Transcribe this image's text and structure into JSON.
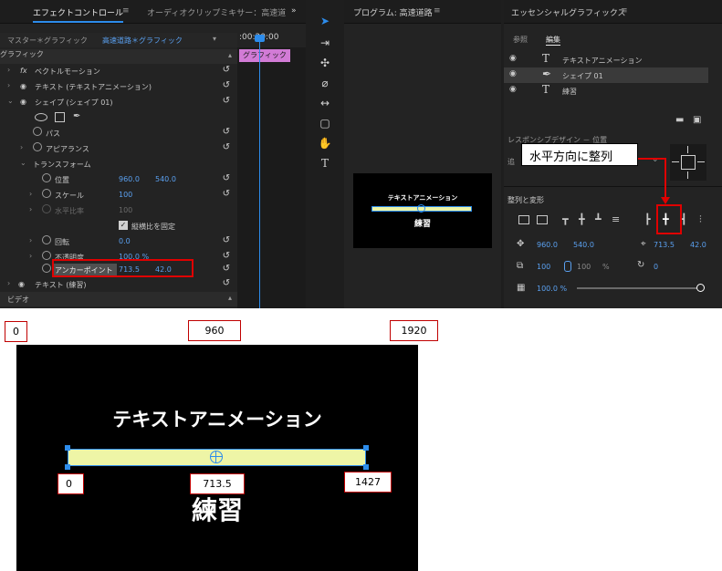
{
  "effect_controls": {
    "tab_title": "エフェクトコントロール",
    "tab_menu": "≡",
    "tab_other": "オーディオクリップミキサー：高速道",
    "overflow": "»",
    "master_label": "マスター＊グラフィック",
    "sequence_label": "高速道路＊グラフィック",
    "timecode": ":00:20:00",
    "clip_label": "グラフィック",
    "source_header": "グラフィック",
    "rows": {
      "vector_motion": "ベクトルモーション",
      "fx": "fx",
      "text_anim": "テキスト (テキストアニメーション)",
      "shape": "シェイプ (シェイプ 01)",
      "path": "パス",
      "appearance": "アピアランス",
      "transform": "トランスフォーム",
      "position": "位置",
      "position_x": "960.0",
      "position_y": "540.0",
      "scale": "スケール",
      "scale_val": "100",
      "scale_h": "水平比率",
      "scale_h_val": "100",
      "uniform": "縦横比を固定",
      "rotation": "回転",
      "rotation_val": "0.0",
      "opacity": "不透明度",
      "opacity_val": "100.0 %",
      "anchor": "アンカーポイント",
      "anchor_x": "713.5",
      "anchor_y": "42.0",
      "text_practice": "テキスト (練習)",
      "video": "ビデオ"
    }
  },
  "program_monitor": {
    "title": "プログラム: 高速道路",
    "menu": "≡",
    "preview_title": "テキストアニメーション",
    "preview_sub": "練習"
  },
  "essential_graphics": {
    "title": "エッセンシャルグラフィックス",
    "menu": "≡",
    "tab_browse": "参照",
    "tab_edit": "編集",
    "layers": [
      {
        "name": "テキストアニメーション",
        "icon": "T"
      },
      {
        "name": "シェイプ 01",
        "icon": "✒"
      },
      {
        "name": "練習",
        "icon": "T"
      }
    ],
    "responsive": "レスポンシブデザイン － 位置",
    "align_title": "整列と変形",
    "pos_x": "960.0",
    "pos_y": "540.0",
    "anchor_x": "713.5",
    "anchor_y": "42.0",
    "scale": "100",
    "scale_h": "100",
    "percent": "%",
    "rotation": "0",
    "opacity": "100.0 %"
  },
  "callout": "水平方向に整列",
  "diagram": {
    "title": "テキストアニメーション",
    "subtitle": "練習",
    "top_left": "0",
    "top_mid": "960",
    "top_right": "1920",
    "bar_left": "0",
    "bar_mid": "713.5",
    "bar_right": "1427"
  },
  "colors": {
    "accent": "#2d8ceb",
    "value_blue": "#5aa0f0",
    "bar_fill": "#eef5a6",
    "highlight_red": "#e00000"
  }
}
